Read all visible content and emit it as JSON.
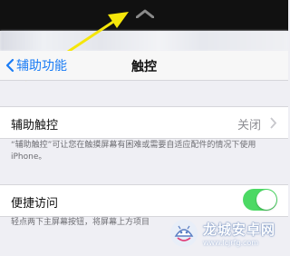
{
  "nav": {
    "back_label": "辅助功能",
    "title": "触控"
  },
  "assistive_touch": {
    "label": "辅助触控",
    "value": "关闭",
    "note": "“辅助触控”可让您在触摸屏幕有困难或需要自适应配件的情况下使用iPhone。"
  },
  "reachability": {
    "label": "便捷访问",
    "toggle_on": true,
    "note": "轻点两下主屏幕按钮，将屏幕上方项目"
  },
  "watermark": {
    "title": "龙城安卓网",
    "url": "www.lcjrfg.com"
  },
  "colors": {
    "accent": "#1a7cf5",
    "toggle_on": "#4cd964",
    "arrow": "#f5e60a"
  }
}
